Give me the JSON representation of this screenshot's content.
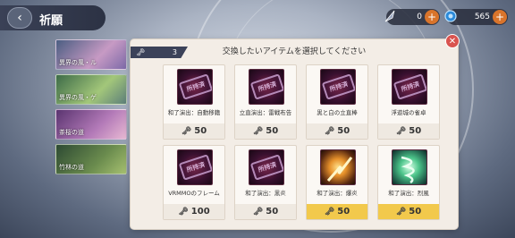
{
  "header": {
    "title": "祈願",
    "back_icon": "‹"
  },
  "currencies": [
    {
      "icon": "feather-icon",
      "value": "0"
    },
    {
      "icon": "gem-icon",
      "value": "565"
    }
  ],
  "side_tabs": [
    {
      "label": "異界の風・ル"
    },
    {
      "label": "異界の風・ゲ"
    },
    {
      "label": "茶桜の道"
    },
    {
      "label": "竹林の道"
    }
  ],
  "dialog": {
    "title": "交換したいアイテムを選択してください",
    "key_count": "3",
    "close_icon": "✕"
  },
  "items": [
    {
      "name": "和了演出：自動移籍",
      "price": "50",
      "owned": true,
      "stamp": "所持済",
      "thumb": "dark",
      "price_style": "normal"
    },
    {
      "name": "立直演出：雷戦布告",
      "price": "50",
      "owned": true,
      "stamp": "所持済",
      "thumb": "dark",
      "price_style": "normal"
    },
    {
      "name": "黒と白の立直棒",
      "price": "50",
      "owned": true,
      "stamp": "所持済",
      "thumb": "dark",
      "price_style": "normal"
    },
    {
      "name": "浮遊城の雀卓",
      "price": "50",
      "owned": true,
      "stamp": "所持済",
      "thumb": "dark",
      "price_style": "normal"
    },
    {
      "name": "VRMMOのフレーム",
      "price": "100",
      "owned": true,
      "stamp": "所持済",
      "thumb": "dark",
      "price_style": "normal"
    },
    {
      "name": "和了演出：黒炎",
      "price": "50",
      "owned": true,
      "stamp": "所持済",
      "thumb": "dark",
      "price_style": "normal"
    },
    {
      "name": "和了演出：爆炎",
      "price": "50",
      "owned": false,
      "stamp": "",
      "thumb": "fire",
      "price_style": "gold"
    },
    {
      "name": "和了演出：烈風",
      "price": "50",
      "owned": false,
      "stamp": "",
      "thumb": "wind",
      "price_style": "gold"
    }
  ],
  "colors": {
    "accent_gold": "#f2c94c",
    "close_red": "#d9534f",
    "header_dark": "#3a4156"
  }
}
